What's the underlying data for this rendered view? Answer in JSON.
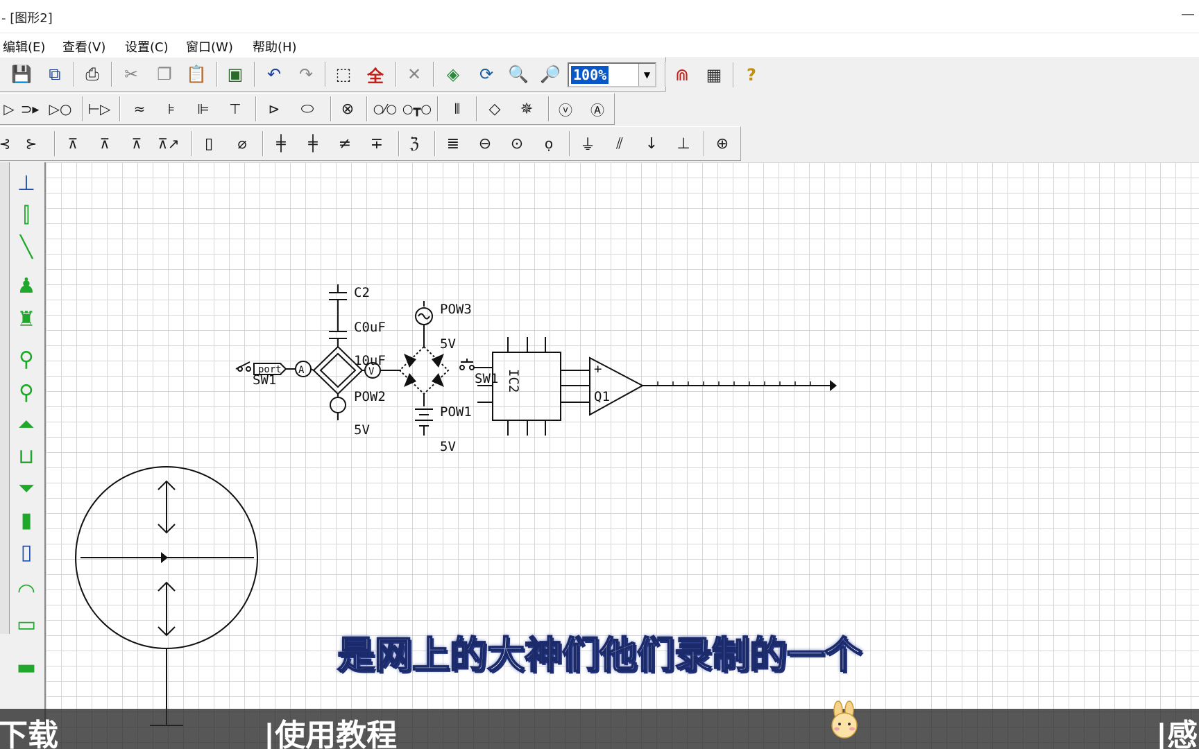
{
  "window": {
    "title": "- [图形2]",
    "minimize_glyph": "—"
  },
  "menu": [
    {
      "label": "编辑(E)"
    },
    {
      "label": "查看(V)"
    },
    {
      "label": "设置(C)"
    },
    {
      "label": "窗口(W)"
    },
    {
      "label": "帮助(H)"
    }
  ],
  "toolbar": {
    "zoom_value": "100%",
    "icons_row1": [
      "save-icon",
      "save-all-icon",
      "print-icon",
      "cut-icon",
      "copy-icon",
      "paste-icon",
      "import-icon",
      "undo-icon",
      "redo-icon",
      "select-icon",
      "select-all-icon",
      "delete-icon",
      "redraw-icon",
      "refresh-icon",
      "zoom-in-icon",
      "zoom-out-icon",
      "magnet-icon",
      "grid-icon",
      "help-icon"
    ],
    "icons_row2": [
      "gate-buffer-icon",
      "gate-or-icon",
      "gate-not-icon",
      "transistor-icon",
      "wave-icon",
      "junction-icon",
      "pin-icon",
      "node-icon",
      "port-icon",
      "connector-icon",
      "lamp-icon",
      "switch-open-icon",
      "switch-push-icon",
      "crystal-icon",
      "bridge-icon",
      "bridge2-icon",
      "voltmeter-icon",
      "ammeter-icon"
    ],
    "icons_row3": [
      "npn-icon",
      "pnp-icon",
      "diode-icon",
      "diode2-icon",
      "zener-icon",
      "led-icon",
      "resistor-icon",
      "varistor-icon",
      "capacitor-icon",
      "capacitor2-icon",
      "capacitor3-icon",
      "capacitor4-icon",
      "inductor-icon",
      "battery-icon",
      "dc-source-icon",
      "ac-source-icon",
      "current-source-icon",
      "ground-icon",
      "chassis-icon",
      "signal-ground-icon",
      "earth-icon",
      "fuse-icon"
    ]
  },
  "palette": [
    "stand-icon",
    "test-tube-icon",
    "rod-icon",
    "burner-icon",
    "burner2-icon",
    "flask-round-icon",
    "flask-round2-icon",
    "flask-conical-icon",
    "beaker-icon",
    "funnel-icon",
    "bottle-icon",
    "cylinder-icon",
    "dish-icon",
    "tank-icon",
    "trough-icon"
  ],
  "schematic": {
    "labels": {
      "c2": "C2",
      "c2_value": "C0uF",
      "cap_value": "10uF",
      "pow3": "POW3",
      "pow3_v": "5V",
      "pow2": "POW2",
      "pow2_v": "5V",
      "pow1": "POW1",
      "pow1_v": "5V",
      "sw1_left": "SW1",
      "sw1_right": "SW1",
      "port": "port",
      "ic2": "IC2",
      "q1": "Q1",
      "plus": "+",
      "ammeter": "A",
      "voltmeter": "V"
    }
  },
  "subtitle": "是网上的大神们他们录制的一个",
  "bottom_band": {
    "left": "下载",
    "middle": "|使用教程",
    "right": "|感"
  },
  "colors": {
    "selection_blue": "#0a58c8",
    "palette_green": "#1fa82c",
    "subtitle_stroke": "#1b2a6b"
  }
}
